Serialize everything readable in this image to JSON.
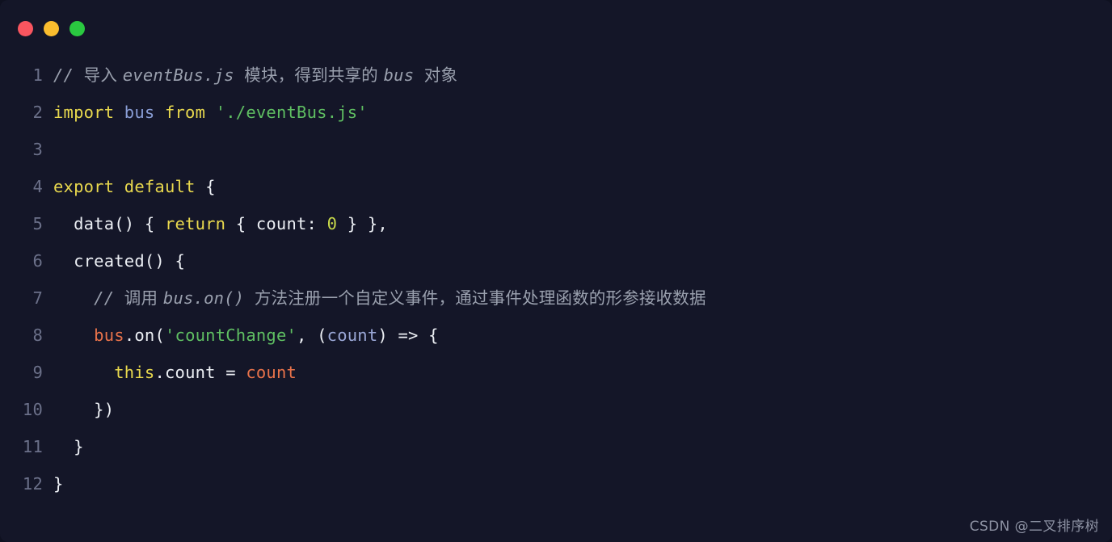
{
  "window": {
    "background_color": "#141628",
    "controls": [
      {
        "name": "close",
        "color": "#f9555f"
      },
      {
        "name": "minimize",
        "color": "#fbbd2e"
      },
      {
        "name": "zoom",
        "color": "#2ac940"
      }
    ]
  },
  "editor": {
    "language": "javascript",
    "theme": "dark-navy",
    "gutter_color": "#6b7089",
    "line_numbers": [
      "1",
      "2",
      "3",
      "4",
      "5",
      "6",
      "7",
      "8",
      "9",
      "10",
      "11",
      "12"
    ],
    "plain_text": [
      "// 导入 eventBus.js 模块，得到共享的 bus 对象",
      "import bus from './eventBus.js'",
      "",
      "export default {",
      "  data() { return { count: 0 } },",
      "  created() {",
      "    // 调用 bus.on() 方法注册一个自定义事件，通过事件处理函数的形参接收数据",
      "    bus.on('countChange', (count) => {",
      "      this.count = count",
      "    })",
      "  }",
      "}"
    ],
    "lines": [
      {
        "num": "1",
        "tokens": [
          {
            "t": "// ",
            "c": "comment"
          },
          {
            "t": "导入 ",
            "c": "comment-cn"
          },
          {
            "t": "eventBus.js ",
            "c": "comment"
          },
          {
            "t": "模块，得到共享的 ",
            "c": "comment-cn"
          },
          {
            "t": "bus ",
            "c": "comment"
          },
          {
            "t": "对象",
            "c": "comment-cn"
          }
        ]
      },
      {
        "num": "2",
        "tokens": [
          {
            "t": "import ",
            "c": "keyword"
          },
          {
            "t": "bus ",
            "c": "var"
          },
          {
            "t": "from ",
            "c": "keyword"
          },
          {
            "t": "'./eventBus.js'",
            "c": "string"
          }
        ]
      },
      {
        "num": "3",
        "tokens": []
      },
      {
        "num": "4",
        "tokens": [
          {
            "t": "export default ",
            "c": "keyword"
          },
          {
            "t": "{",
            "c": "plain"
          }
        ]
      },
      {
        "num": "5",
        "tokens": [
          {
            "t": "  data() { ",
            "c": "plain"
          },
          {
            "t": "return ",
            "c": "keyword"
          },
          {
            "t": "{ count: ",
            "c": "plain"
          },
          {
            "t": "0",
            "c": "number"
          },
          {
            "t": " } },",
            "c": "plain"
          }
        ]
      },
      {
        "num": "6",
        "tokens": [
          {
            "t": "  created() {",
            "c": "plain"
          }
        ]
      },
      {
        "num": "7",
        "tokens": [
          {
            "t": "    // ",
            "c": "comment"
          },
          {
            "t": "调用 ",
            "c": "comment-cn"
          },
          {
            "t": "bus.on() ",
            "c": "comment"
          },
          {
            "t": "方法注册一个自定义事件，通过事件处理函数的形参接收数据",
            "c": "comment-cn"
          }
        ]
      },
      {
        "num": "8",
        "tokens": [
          {
            "t": "    ",
            "c": "plain"
          },
          {
            "t": "bus",
            "c": "object"
          },
          {
            "t": ".on(",
            "c": "plain"
          },
          {
            "t": "'countChange'",
            "c": "string"
          },
          {
            "t": ", (",
            "c": "plain"
          },
          {
            "t": "count",
            "c": "param"
          },
          {
            "t": ") => {",
            "c": "plain"
          }
        ]
      },
      {
        "num": "9",
        "tokens": [
          {
            "t": "      ",
            "c": "plain"
          },
          {
            "t": "this",
            "c": "this"
          },
          {
            "t": ".count = ",
            "c": "plain"
          },
          {
            "t": "count",
            "c": "object"
          }
        ]
      },
      {
        "num": "10",
        "tokens": [
          {
            "t": "    })",
            "c": "plain"
          }
        ]
      },
      {
        "num": "11",
        "tokens": [
          {
            "t": "  }",
            "c": "plain"
          }
        ]
      },
      {
        "num": "12",
        "tokens": [
          {
            "t": "}",
            "c": "plain"
          }
        ]
      }
    ]
  },
  "watermark": {
    "text": "CSDN @二叉排序树"
  }
}
